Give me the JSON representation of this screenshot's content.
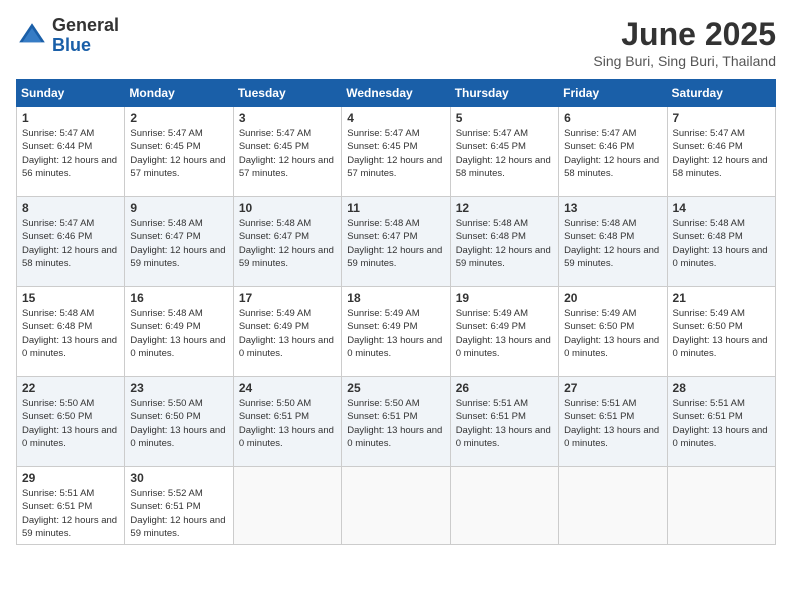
{
  "logo": {
    "general": "General",
    "blue": "Blue"
  },
  "title": "June 2025",
  "location": "Sing Buri, Sing Buri, Thailand",
  "weekdays": [
    "Sunday",
    "Monday",
    "Tuesday",
    "Wednesday",
    "Thursday",
    "Friday",
    "Saturday"
  ],
  "weeks": [
    [
      {
        "day": "1",
        "sunrise": "5:47 AM",
        "sunset": "6:44 PM",
        "daylight": "12 hours and 56 minutes."
      },
      {
        "day": "2",
        "sunrise": "5:47 AM",
        "sunset": "6:45 PM",
        "daylight": "12 hours and 57 minutes."
      },
      {
        "day": "3",
        "sunrise": "5:47 AM",
        "sunset": "6:45 PM",
        "daylight": "12 hours and 57 minutes."
      },
      {
        "day": "4",
        "sunrise": "5:47 AM",
        "sunset": "6:45 PM",
        "daylight": "12 hours and 57 minutes."
      },
      {
        "day": "5",
        "sunrise": "5:47 AM",
        "sunset": "6:45 PM",
        "daylight": "12 hours and 58 minutes."
      },
      {
        "day": "6",
        "sunrise": "5:47 AM",
        "sunset": "6:46 PM",
        "daylight": "12 hours and 58 minutes."
      },
      {
        "day": "7",
        "sunrise": "5:47 AM",
        "sunset": "6:46 PM",
        "daylight": "12 hours and 58 minutes."
      }
    ],
    [
      {
        "day": "8",
        "sunrise": "5:47 AM",
        "sunset": "6:46 PM",
        "daylight": "12 hours and 58 minutes."
      },
      {
        "day": "9",
        "sunrise": "5:48 AM",
        "sunset": "6:47 PM",
        "daylight": "12 hours and 59 minutes."
      },
      {
        "day": "10",
        "sunrise": "5:48 AM",
        "sunset": "6:47 PM",
        "daylight": "12 hours and 59 minutes."
      },
      {
        "day": "11",
        "sunrise": "5:48 AM",
        "sunset": "6:47 PM",
        "daylight": "12 hours and 59 minutes."
      },
      {
        "day": "12",
        "sunrise": "5:48 AM",
        "sunset": "6:48 PM",
        "daylight": "12 hours and 59 minutes."
      },
      {
        "day": "13",
        "sunrise": "5:48 AM",
        "sunset": "6:48 PM",
        "daylight": "12 hours and 59 minutes."
      },
      {
        "day": "14",
        "sunrise": "5:48 AM",
        "sunset": "6:48 PM",
        "daylight": "13 hours and 0 minutes."
      }
    ],
    [
      {
        "day": "15",
        "sunrise": "5:48 AM",
        "sunset": "6:48 PM",
        "daylight": "13 hours and 0 minutes."
      },
      {
        "day": "16",
        "sunrise": "5:48 AM",
        "sunset": "6:49 PM",
        "daylight": "13 hours and 0 minutes."
      },
      {
        "day": "17",
        "sunrise": "5:49 AM",
        "sunset": "6:49 PM",
        "daylight": "13 hours and 0 minutes."
      },
      {
        "day": "18",
        "sunrise": "5:49 AM",
        "sunset": "6:49 PM",
        "daylight": "13 hours and 0 minutes."
      },
      {
        "day": "19",
        "sunrise": "5:49 AM",
        "sunset": "6:49 PM",
        "daylight": "13 hours and 0 minutes."
      },
      {
        "day": "20",
        "sunrise": "5:49 AM",
        "sunset": "6:50 PM",
        "daylight": "13 hours and 0 minutes."
      },
      {
        "day": "21",
        "sunrise": "5:49 AM",
        "sunset": "6:50 PM",
        "daylight": "13 hours and 0 minutes."
      }
    ],
    [
      {
        "day": "22",
        "sunrise": "5:50 AM",
        "sunset": "6:50 PM",
        "daylight": "13 hours and 0 minutes."
      },
      {
        "day": "23",
        "sunrise": "5:50 AM",
        "sunset": "6:50 PM",
        "daylight": "13 hours and 0 minutes."
      },
      {
        "day": "24",
        "sunrise": "5:50 AM",
        "sunset": "6:51 PM",
        "daylight": "13 hours and 0 minutes."
      },
      {
        "day": "25",
        "sunrise": "5:50 AM",
        "sunset": "6:51 PM",
        "daylight": "13 hours and 0 minutes."
      },
      {
        "day": "26",
        "sunrise": "5:51 AM",
        "sunset": "6:51 PM",
        "daylight": "13 hours and 0 minutes."
      },
      {
        "day": "27",
        "sunrise": "5:51 AM",
        "sunset": "6:51 PM",
        "daylight": "13 hours and 0 minutes."
      },
      {
        "day": "28",
        "sunrise": "5:51 AM",
        "sunset": "6:51 PM",
        "daylight": "13 hours and 0 minutes."
      }
    ],
    [
      {
        "day": "29",
        "sunrise": "5:51 AM",
        "sunset": "6:51 PM",
        "daylight": "12 hours and 59 minutes."
      },
      {
        "day": "30",
        "sunrise": "5:52 AM",
        "sunset": "6:51 PM",
        "daylight": "12 hours and 59 minutes."
      },
      null,
      null,
      null,
      null,
      null
    ]
  ]
}
